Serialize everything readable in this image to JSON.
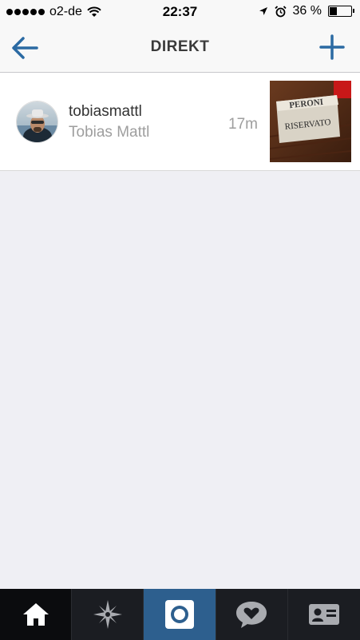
{
  "status_bar": {
    "carrier": "o2-de",
    "time": "22:37",
    "battery_percent": "36 %",
    "battery_level": 0.36
  },
  "nav": {
    "title": "DIREKT",
    "back_icon": "back-arrow-icon",
    "add_icon": "plus-icon"
  },
  "threads": [
    {
      "username": "tobiasmattl",
      "full_name": "Tobias Mattl",
      "time_ago": "17m",
      "thumbnail_text_top": "PERONI",
      "thumbnail_text_bottom": "RISERVATO"
    }
  ],
  "tab_bar": {
    "tabs": [
      {
        "icon": "home-icon",
        "active": true
      },
      {
        "icon": "explore-icon",
        "active": false
      },
      {
        "icon": "camera-icon",
        "active": false
      },
      {
        "icon": "activity-icon",
        "active": false
      },
      {
        "icon": "profile-icon",
        "active": false
      }
    ]
  },
  "colors": {
    "accent": "#2b6aa3",
    "background": "#efeff4",
    "tab_bar": "#1b1d22",
    "camera_tab": "#2d5f8e"
  }
}
